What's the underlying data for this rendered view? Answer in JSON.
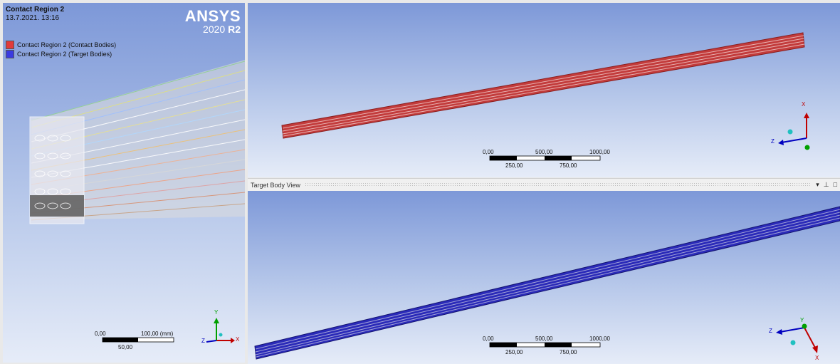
{
  "main_view": {
    "title": "Contact Region 2",
    "date": "13.7.2021. 13:16",
    "legend": [
      {
        "label": "Contact Region 2 (Contact Bodies)",
        "color": "#e23a3a"
      },
      {
        "label": "Contact Region 2 (Target Bodies)",
        "color": "#3a3ae0"
      }
    ],
    "brand_name": "ANSYS",
    "brand_version_year": "2020",
    "brand_version_rel": "R2",
    "scale": {
      "left": "0,00",
      "right": "100,00 (mm)",
      "mid": "50,00"
    },
    "triad": {
      "y": "Y",
      "z": "Z",
      "x": "X"
    }
  },
  "contact_view": {
    "scale": {
      "left": "0,00",
      "t1": "500,00",
      "t2": "1000,00",
      "b1": "250,00",
      "b2": "750,00"
    },
    "triad": {
      "x": "X",
      "z": "Z"
    },
    "body_color": "#c23b3b"
  },
  "target_pane": {
    "title": "Target Body View",
    "controls": {
      "dropdown": "▾",
      "pin": "⊥",
      "maximize": "□"
    }
  },
  "target_view": {
    "scale": {
      "left": "0,00",
      "t1": "500,00",
      "t2": "1000,00",
      "b1": "250,00",
      "b2": "750,00"
    },
    "triad": {
      "y": "Y",
      "z": "Z",
      "x": "X"
    },
    "body_color": "#2a2ab8"
  }
}
